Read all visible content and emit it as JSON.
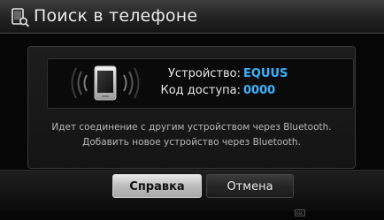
{
  "header": {
    "title": "Поиск в телефоне",
    "icon": "phone-search-icon"
  },
  "device": {
    "icon": "phone-bluetooth-icon",
    "device_label": "Устройство:",
    "device_value": "EQUUS",
    "code_label": "Код доступа:",
    "code_value": "0000"
  },
  "messages": {
    "line1": "Идет соединение с другим устройством через Bluetooth.",
    "line2": "Добавить новое устройство через Bluetooth."
  },
  "buttons": {
    "help_label": "Справка",
    "cancel_label": "Отмена"
  },
  "footer": {
    "esc_label": "ESC"
  },
  "colors": {
    "accent_value": "#38b4ff",
    "background": "#060606"
  }
}
